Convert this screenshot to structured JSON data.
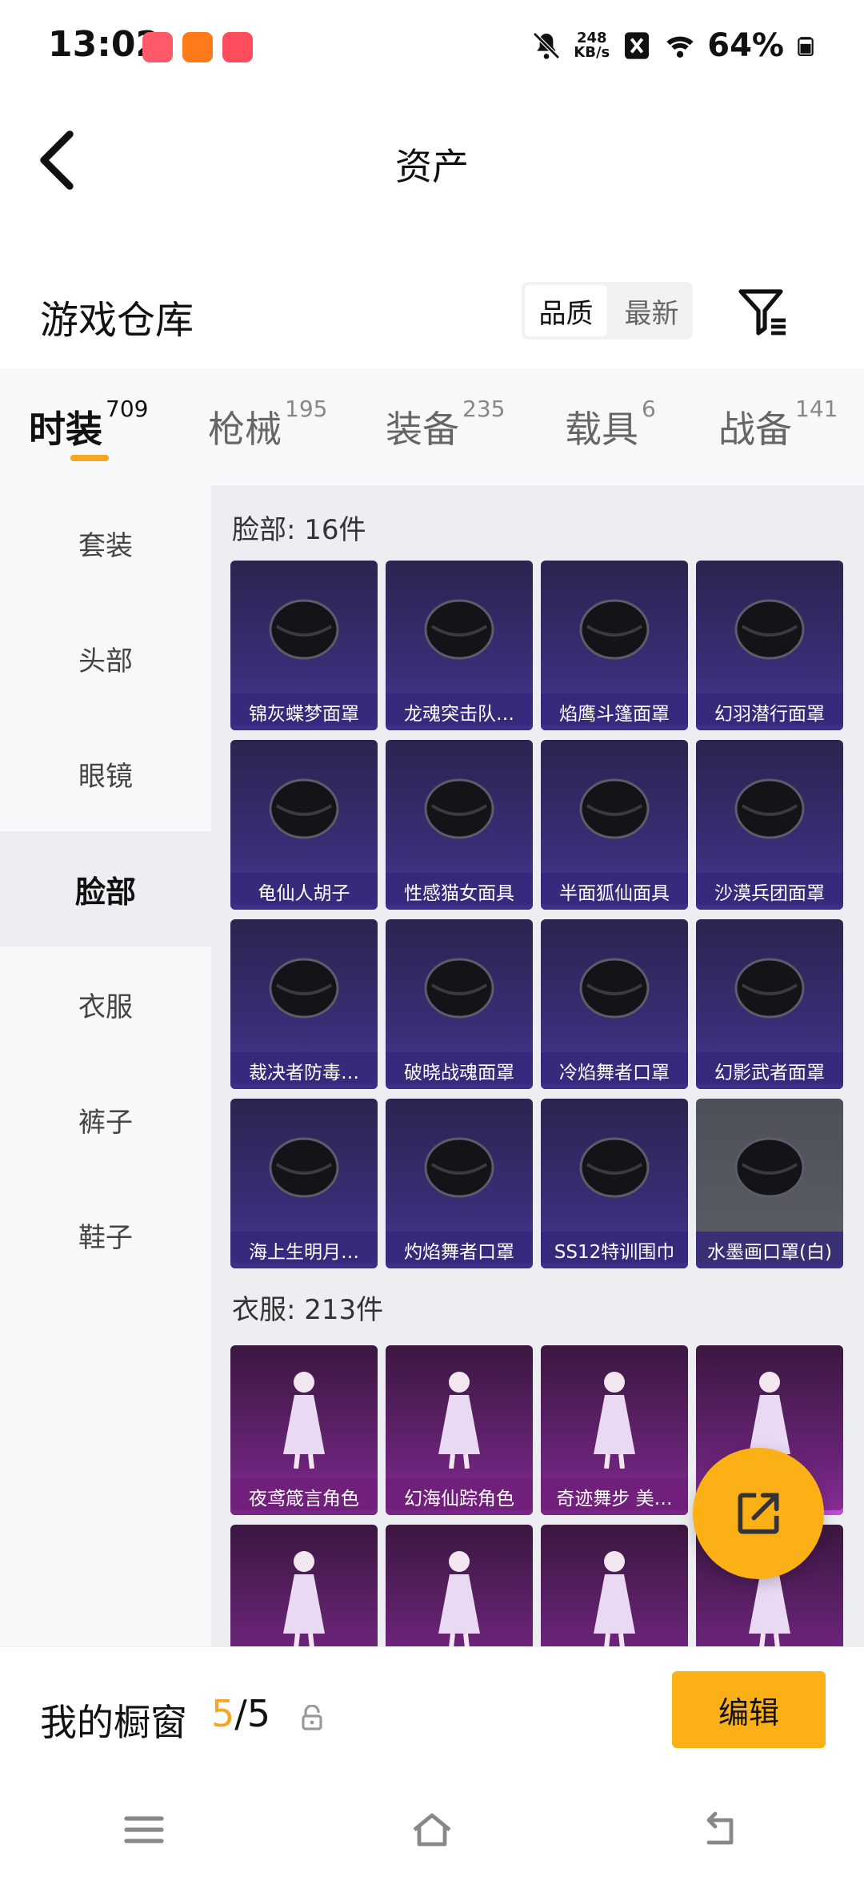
{
  "status_bar": {
    "time": "13:02",
    "net_speed_value": "248",
    "net_speed_unit": "KB/s",
    "battery": "64%",
    "icons": [
      "bell-off-icon",
      "x-box-icon",
      "wifi-icon",
      "battery-icon"
    ]
  },
  "header": {
    "title": "资产",
    "back_icon": "chevron-left-icon"
  },
  "warehouse": {
    "title": "游戏仓库",
    "sort_options": [
      "品质",
      "最新"
    ],
    "sort_selected": "品质",
    "filter_icon": "filter-icon"
  },
  "tabs": [
    {
      "label": "时装",
      "count": "709",
      "active": true
    },
    {
      "label": "枪械",
      "count": "195"
    },
    {
      "label": "装备",
      "count": "235"
    },
    {
      "label": "载具",
      "count": "6"
    },
    {
      "label": "战备",
      "count": "141"
    }
  ],
  "sidebar": {
    "items": [
      "套装",
      "头部",
      "眼镜",
      "脸部",
      "衣服",
      "裤子",
      "鞋子"
    ],
    "active": "脸部"
  },
  "categories": [
    {
      "title": "脸部: 16件",
      "items": [
        "锦灰蝶梦面罩",
        "龙魂突击队…",
        "焰鹰斗篷面罩",
        "幻羽潜行面罩",
        "龟仙人胡子",
        "性感猫女面具",
        "半面狐仙面具",
        "沙漠兵团面罩",
        "裁决者防毒…",
        "破晓战魂面罩",
        "冷焰舞者口罩",
        "幻影武者面罩",
        "海上生明月…",
        "灼焰舞者口罩",
        "SS12特训围巾",
        "水墨画口罩(白)"
      ]
    },
    {
      "title": "衣服: 213件",
      "items": [
        "夜鸢箴言角色",
        "幻海仙踪角色",
        "奇迹舞步 美…",
        "",
        "",
        "",
        "",
        ""
      ]
    }
  ],
  "fab": {
    "icon": "external-link-icon"
  },
  "showcase": {
    "label": "我的橱窗",
    "current": "5",
    "sep": "/",
    "total": "5",
    "lock_icon": "lock-icon",
    "edit_label": "编辑"
  },
  "navbar": {
    "icons": [
      "menu-icon",
      "home-icon",
      "back-icon"
    ]
  },
  "colors": {
    "accent": "#fbb016",
    "face_card": "#3a2f7a",
    "cloth_card": "#6a2478"
  }
}
